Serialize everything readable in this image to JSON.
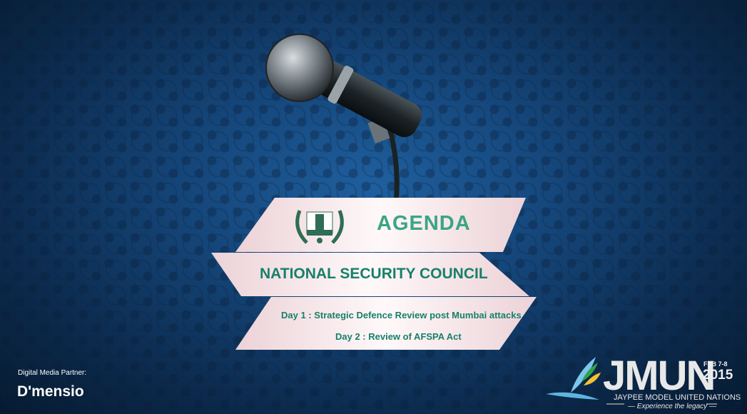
{
  "poster": {
    "heading": "AGENDA",
    "committee": "NATIONAL SECURITY COUNCIL",
    "day1": "Day 1 : Strategic Defence Review post Mumbai attacks",
    "day2": "Day 2 : Review of AFSPA Act"
  },
  "partner": {
    "label": "Digital Media Partner:",
    "name": "D'mensio"
  },
  "logo": {
    "name": "JMUN",
    "date": "FEB 7-8",
    "year": "2015",
    "full_name": "JAYPEE MODEL UNITED NATIONS",
    "tagline": "— Experience the legacy —"
  },
  "colors": {
    "ribbon": "#f6e3e6",
    "text_green": "#17806a",
    "background": "#15467a"
  }
}
